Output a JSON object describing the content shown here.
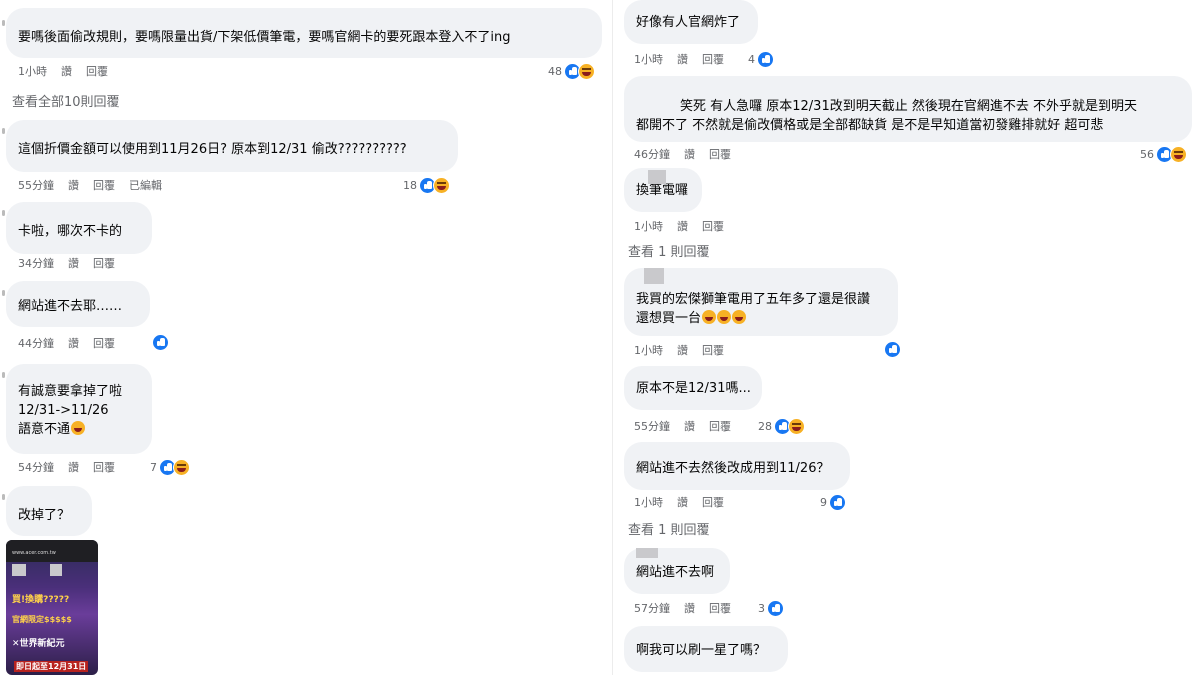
{
  "labels": {
    "like": "讚",
    "reply": "回覆",
    "edited": "已編輯"
  },
  "left": [
    {
      "lines": [
        "要嗎後面偷改規則，要嗎限量出貨/下架低價筆電，要嗎官網卡的要死跟本登入不了ing"
      ],
      "time": "1小時",
      "count": "48",
      "reactions": [
        "like",
        "haha"
      ]
    },
    {
      "view_more": "查看全部10則回覆"
    },
    {
      "lines": [
        "這個折價金額可以使用到11月26日? 原本到12/31 偷改??????????"
      ],
      "time": "55分鐘",
      "edited": true,
      "count": "18",
      "reactions": [
        "like",
        "haha"
      ]
    },
    {
      "lines": [
        "卡啦，哪次不卡的"
      ],
      "time": "34分鐘"
    },
    {
      "lines": [
        "網站進不去耶……"
      ],
      "time": "44分鐘",
      "count": "",
      "reactions": [
        "like"
      ]
    },
    {
      "lines": [
        "有誠意要拿掉了啦",
        "12/31->11/26",
        "語意不通"
      ],
      "emoji_last": true,
      "time": "54分鐘",
      "count": "7",
      "reactions": [
        "like",
        "haha"
      ]
    },
    {
      "lines": [
        "改掉了？"
      ],
      "image": {
        "url_text": "www.acer.com.tw",
        "t1": "買!換購?????",
        "t2": "官網限定$$$$$",
        "t3": "✕世界新紀元",
        "t4": "即日起至12月31日"
      }
    }
  ],
  "right": [
    {
      "lines": [
        "好像有人官網炸了"
      ],
      "time": "1小時",
      "count": "4",
      "reactions": [
        "like"
      ]
    },
    {
      "lines": [
        "笑死 有人急囉 原本12/31改到明天截止 然後現在官網進不去 不外乎就是到明天",
        "都開不了 不然就是偷改價格或是全部都缺貨 是不是早知道當初發雞排就好 超可悲"
      ],
      "time": "46分鐘",
      "count": "56",
      "reactions": [
        "like",
        "haha"
      ]
    },
    {
      "lines": [
        "換筆電囉"
      ],
      "time": "1小時"
    },
    {
      "view_more": "查看 1 則回覆"
    },
    {
      "lines": [
        "我買的宏傑獅筆電用了五年多了還是很讚",
        "還想買一台"
      ],
      "emoji_last3": true,
      "time": "1小時",
      "count": "",
      "reactions": [
        "like"
      ]
    },
    {
      "lines": [
        "原本不是12/31嗎..."
      ],
      "time": "55分鐘",
      "count": "28",
      "reactions": [
        "like",
        "haha"
      ]
    },
    {
      "lines": [
        "網站進不去然後改成用到11/26？"
      ],
      "time": "1小時",
      "count": "9",
      "reactions": [
        "like"
      ]
    },
    {
      "view_more": "查看 1 則回覆"
    },
    {
      "lines": [
        "網站進不去啊"
      ],
      "time": "57分鐘",
      "count": "3",
      "reactions": [
        "like"
      ]
    },
    {
      "lines": [
        "啊我可以刷一星了嗎？"
      ]
    }
  ]
}
